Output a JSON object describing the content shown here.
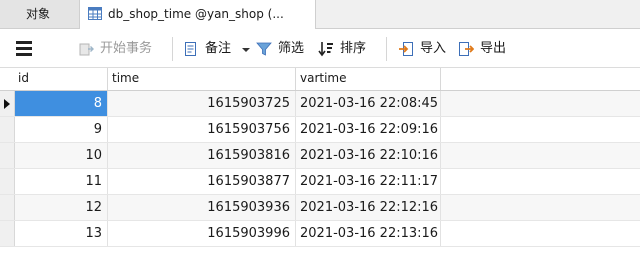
{
  "tabs": {
    "objects": "对象",
    "table": "db_shop_time @yan_shop (..."
  },
  "toolbar": {
    "begin_transaction": "开始事务",
    "note": "备注",
    "filter": "筛选",
    "sort": "排序",
    "import": "导入",
    "export": "导出",
    "icons": {
      "menu": "hamburger-menu-icon",
      "begin": "begin-transaction-icon",
      "note": "note-icon",
      "filter": "filter-funnel-icon",
      "sort": "sort-icon",
      "import": "import-icon",
      "export": "export-icon"
    }
  },
  "grid": {
    "columns": [
      "id",
      "time",
      "vartime"
    ],
    "rows": [
      {
        "id": "8",
        "time": "1615903725",
        "vartime": "2021-03-16 22:08:45"
      },
      {
        "id": "9",
        "time": "1615903756",
        "vartime": "2021-03-16 22:09:16"
      },
      {
        "id": "10",
        "time": "1615903816",
        "vartime": "2021-03-16 22:10:16"
      },
      {
        "id": "11",
        "time": "1615903877",
        "vartime": "2021-03-16 22:11:17"
      },
      {
        "id": "12",
        "time": "1615903936",
        "vartime": "2021-03-16 22:12:16"
      },
      {
        "id": "13",
        "time": "1615903996",
        "vartime": "2021-03-16 22:13:16"
      }
    ],
    "selected_row": 0
  },
  "colors": {
    "selection": "#3f8fe0",
    "tab_active": "#ffffff",
    "tab_inactive": "#e4e4e4"
  }
}
